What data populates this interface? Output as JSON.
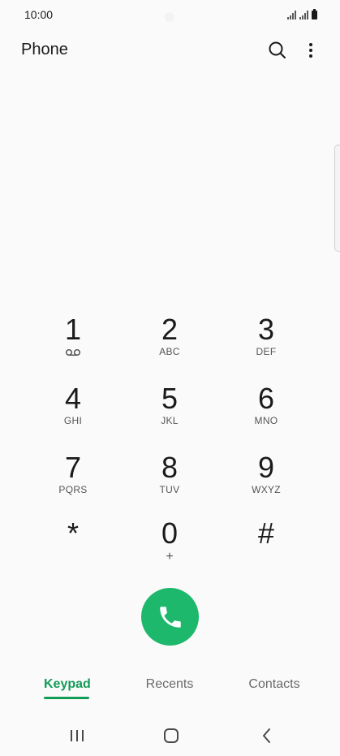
{
  "status_bar": {
    "time": "10:00"
  },
  "app_bar": {
    "title": "Phone",
    "search_icon": "search-icon",
    "more_icon": "more-vertical-icon"
  },
  "keypad": [
    {
      "digit": "1",
      "letters": "",
      "sub_icon": "voicemail-icon"
    },
    {
      "digit": "2",
      "letters": "ABC"
    },
    {
      "digit": "3",
      "letters": "DEF"
    },
    {
      "digit": "4",
      "letters": "GHI"
    },
    {
      "digit": "5",
      "letters": "JKL"
    },
    {
      "digit": "6",
      "letters": "MNO"
    },
    {
      "digit": "7",
      "letters": "PQRS"
    },
    {
      "digit": "8",
      "letters": "TUV"
    },
    {
      "digit": "9",
      "letters": "WXYZ"
    },
    {
      "digit": "*",
      "letters": ""
    },
    {
      "digit": "0",
      "letters": "+"
    },
    {
      "digit": "#",
      "letters": ""
    }
  ],
  "call_button": {
    "icon": "phone-icon",
    "color": "#1db86c"
  },
  "tabs": [
    {
      "label": "Keypad",
      "active": true
    },
    {
      "label": "Recents",
      "active": false
    },
    {
      "label": "Contacts",
      "active": false
    }
  ],
  "colors": {
    "accent": "#139b58",
    "call": "#1db86c",
    "background": "#fafafa"
  },
  "nav_bar": {
    "recents_icon": "recent-apps-icon",
    "home_icon": "home-icon",
    "back_icon": "back-icon"
  }
}
